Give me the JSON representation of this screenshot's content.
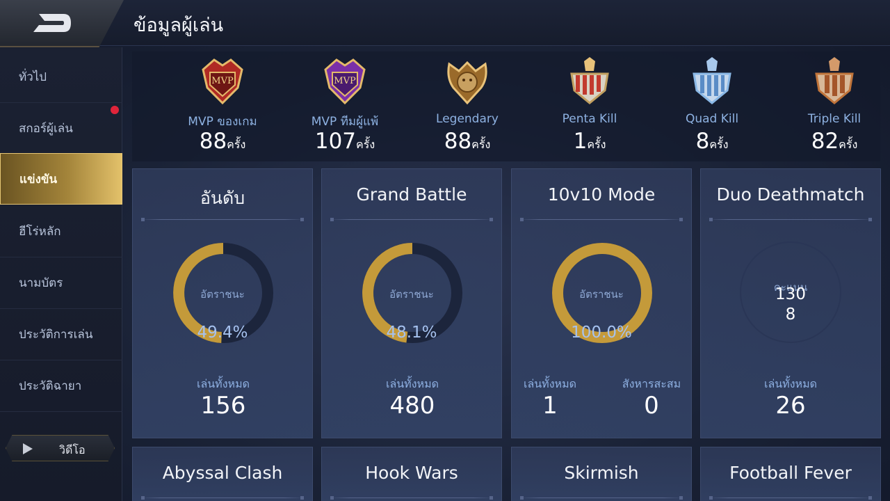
{
  "header": {
    "title": "ข้อมูลผู้เล่น",
    "back_icon": "back-arrow-icon"
  },
  "sidebar": {
    "items": [
      {
        "label": "ทั่วไป"
      },
      {
        "label": "สกอร์ผู้เล่น"
      },
      {
        "label": "แข่งขัน",
        "active": true
      },
      {
        "label": "ฮีโร่หลัก"
      },
      {
        "label": "นามบัตร"
      },
      {
        "label": "ประวัติการเล่น"
      },
      {
        "label": "ประวัติฉายา"
      }
    ],
    "video_label": "วิดีโอ",
    "notification_color": "#e0243a"
  },
  "achievements": [
    {
      "label": "MVP ของเกม",
      "value": "88",
      "unit": "ครั้ง",
      "badge_text": "MVP",
      "color": "#b02a24"
    },
    {
      "label": "MVP ทีมผู้แพ้",
      "value": "107",
      "unit": "ครั้ง",
      "badge_text": "MVP",
      "color": "#7a2fa8"
    },
    {
      "label": "Legendary",
      "value": "88",
      "unit": "ครั้ง",
      "badge_text": "",
      "color": "#c08a3a"
    },
    {
      "label": "Penta Kill",
      "value": "1",
      "unit": "ครั้ง",
      "badge_text": "",
      "color": "#c23a2e"
    },
    {
      "label": "Quad Kill",
      "value": "8",
      "unit": "ครั้ง",
      "badge_text": "",
      "color": "#8ab8e6"
    },
    {
      "label": "Triple Kill",
      "value": "82",
      "unit": "ครั้ง",
      "badge_text": "",
      "color": "#c0743a"
    }
  ],
  "cards": [
    {
      "title": "อันดับ",
      "ring_label": "อัตราชนะ",
      "win_rate_text": "49.4%",
      "win_rate": 0.494,
      "stat_label": "เล่นทั้งหมด",
      "stat_value": "156"
    },
    {
      "title": "Grand Battle",
      "ring_label": "อัตราชนะ",
      "win_rate_text": "48.1%",
      "win_rate": 0.481,
      "stat_label": "เล่นทั้งหมด",
      "stat_value": "480"
    },
    {
      "title": "10v10 Mode",
      "ring_label": "อัตราชนะ",
      "win_rate_text": "100.0%",
      "win_rate": 1.0,
      "stat_label": "เล่นทั้งหมด",
      "stat_value": "1",
      "stat2_label": "สังหารสะสม",
      "stat2_value": "0"
    },
    {
      "title": "Duo Deathmatch",
      "score_label": "คะแนน",
      "score_value": "130",
      "score_value2": "8",
      "stat_label": "เล่นทั้งหมด",
      "stat_value": "26"
    }
  ],
  "bottom_cards": [
    {
      "title": "Abyssal Clash"
    },
    {
      "title": "Hook Wars"
    },
    {
      "title": "Skirmish"
    },
    {
      "title": "Football Fever"
    }
  ],
  "colors": {
    "ring_gold": "#c49a3a",
    "ring_track": "#1c253c",
    "accent_gold": "#e3c16a"
  }
}
